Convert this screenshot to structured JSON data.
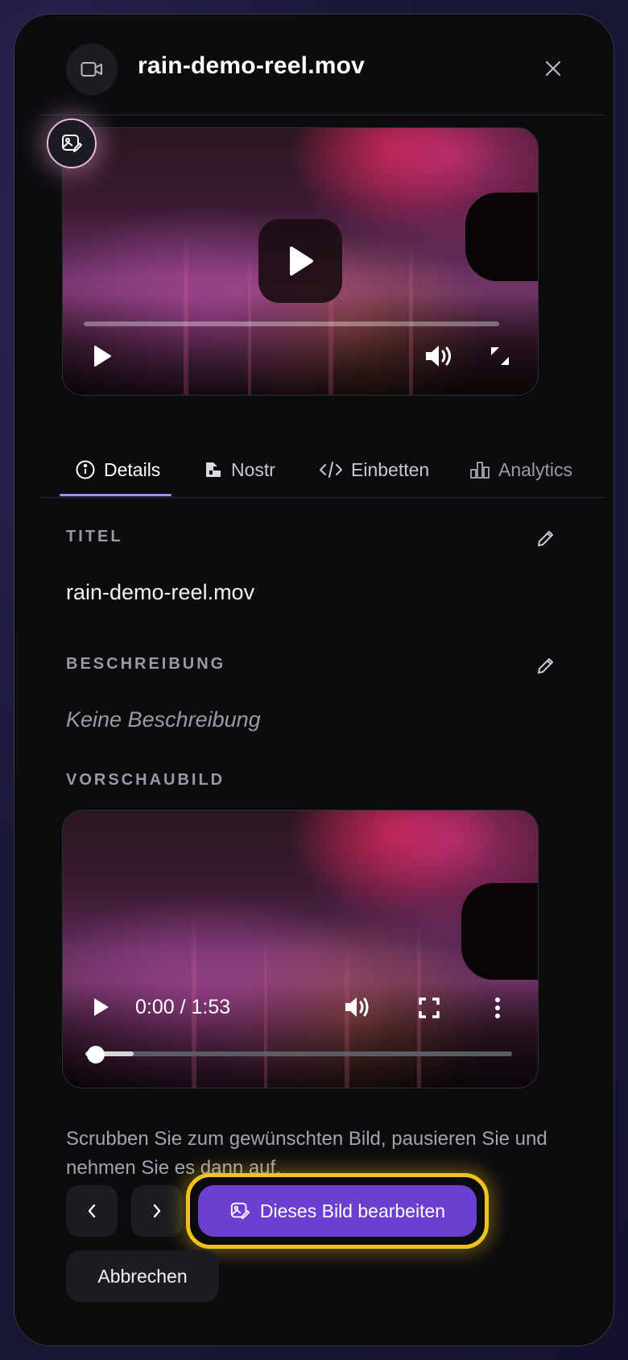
{
  "header": {
    "title": "rain-demo-reel.mov",
    "file_icon": "video-camera-icon",
    "close_icon": "close-icon"
  },
  "player": {
    "play_icon": "play-icon",
    "volume_icon": "volume-icon",
    "expand_icon": "expand-icon",
    "progress": 0
  },
  "tabs": [
    {
      "label": "Details",
      "icon": "info-icon",
      "active": true
    },
    {
      "label": "Nostr",
      "icon": "nostr-icon",
      "active": false
    },
    {
      "label": "Einbetten",
      "icon": "code-icon",
      "active": false
    },
    {
      "label": "Analytics",
      "icon": "bar-chart-icon",
      "active": false
    }
  ],
  "details": {
    "title_label": "TITEL",
    "title_value": "rain-demo-reel.mov",
    "description_label": "BESCHREIBUNG",
    "description_value": "Keine Beschreibung",
    "thumbnail_label": "VORSCHAUBILD"
  },
  "thumbnail_player": {
    "time": "0:00 / 1:53",
    "progress": 0.0
  },
  "hint": "Scrubben Sie zum gewünschten Bild, pausieren Sie und nehmen Sie es dann auf.",
  "actions": {
    "prev_icon": "chevron-left-icon",
    "next_icon": "chevron-right-icon",
    "edit_label": "Dieses Bild bearbeiten",
    "cancel_label": "Abbrechen"
  },
  "colors": {
    "accent": "#6c3fd1",
    "highlight": "#f1c21e",
    "tab_underline": "#9f8cf5"
  }
}
